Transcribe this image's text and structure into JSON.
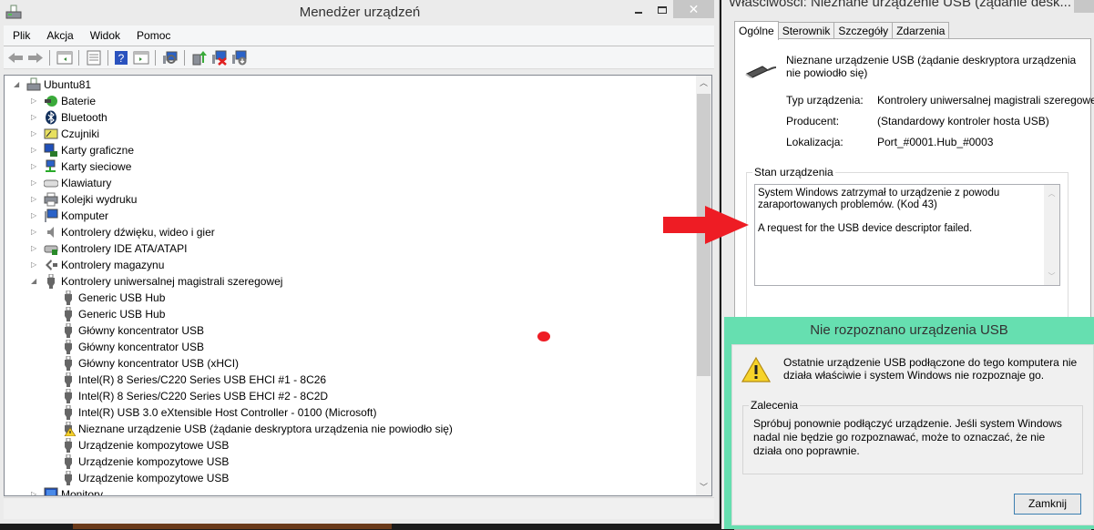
{
  "device_manager": {
    "title": "Menedżer urządzeń",
    "menu": [
      "Plik",
      "Akcja",
      "Widok",
      "Pomoc"
    ],
    "toolbar_icons": [
      "back-arrow-icon",
      "forward-arrow-icon",
      "show-hide-console-tree-icon",
      "properties-icon",
      "help-icon",
      "action-pane-icon",
      "scan-hardware-icon",
      "update-driver-icon",
      "uninstall-device-icon",
      "disable-device-icon"
    ],
    "tree": {
      "root": "Ubuntu81",
      "categories": [
        {
          "label": "Baterie",
          "icon": "battery-icon"
        },
        {
          "label": "Bluetooth",
          "icon": "bluetooth-icon"
        },
        {
          "label": "Czujniki",
          "icon": "sensor-icon"
        },
        {
          "label": "Karty graficzne",
          "icon": "display-adapter-icon"
        },
        {
          "label": "Karty sieciowe",
          "icon": "network-adapter-icon"
        },
        {
          "label": "Klawiatury",
          "icon": "keyboard-icon"
        },
        {
          "label": "Kolejki wydruku",
          "icon": "printer-icon"
        },
        {
          "label": "Komputer",
          "icon": "computer-icon"
        },
        {
          "label": "Kontrolery dźwięku, wideo i gier",
          "icon": "speaker-icon"
        },
        {
          "label": "Kontrolery IDE ATA/ATAPI",
          "icon": "ide-controller-icon"
        },
        {
          "label": "Kontrolery magazynu",
          "icon": "storage-controller-icon"
        },
        {
          "label": "Kontrolery uniwersalnej magistrali szeregowej",
          "icon": "usb-plug-icon",
          "expanded": true
        }
      ],
      "usb_children": [
        {
          "label": "Generic USB Hub",
          "warning": false
        },
        {
          "label": "Generic USB Hub",
          "warning": false
        },
        {
          "label": "Główny koncentrator USB",
          "warning": false
        },
        {
          "label": "Główny koncentrator USB",
          "warning": false
        },
        {
          "label": "Główny koncentrator USB (xHCI)",
          "warning": false
        },
        {
          "label": "Intel(R) 8 Series/C220 Series USB EHCI #1 - 8C26",
          "warning": false
        },
        {
          "label": "Intel(R) 8 Series/C220 Series USB EHCI #2 - 8C2D",
          "warning": false
        },
        {
          "label": "Intel(R) USB 3.0 eXtensible Host Controller - 0100 (Microsoft)",
          "warning": false
        },
        {
          "label": "Nieznane urządzenie USB (żądanie deskryptora urządzenia nie powiodło się)",
          "warning": true
        },
        {
          "label": "Urządzenie kompozytowe USB",
          "warning": false
        },
        {
          "label": "Urządzenie kompozytowe USB",
          "warning": false
        },
        {
          "label": "Urządzenie kompozytowe USB",
          "warning": false
        }
      ],
      "after": [
        {
          "label": "Monitory",
          "icon": "monitor-icon"
        }
      ]
    }
  },
  "properties": {
    "title": "Właściwości: Nieznane urządzenie USB (żądanie desk...",
    "tabs": [
      "Ogólne",
      "Sterownik",
      "Szczegóły",
      "Zdarzenia"
    ],
    "active_tab": "Ogólne",
    "device_name": "Nieznane urządzenie USB (żądanie deskryptora urządzenia nie powiodło się)",
    "rows": [
      {
        "key": "Typ urządzenia:",
        "value": "Kontrolery uniwersalnej magistrali szeregowej"
      },
      {
        "key": "Producent:",
        "value": "(Standardowy kontroler hosta USB)"
      },
      {
        "key": "Lokalizacja:",
        "value": "Port_#0001.Hub_#0003"
      }
    ],
    "status_label": "Stan urządzenia",
    "status_text_1": "System Windows zatrzymał to urządzenie z powodu zaraportowanych problemów. (Kod 43)",
    "status_text_2": "A request for the USB device descriptor failed."
  },
  "usb_dialog": {
    "title": "Nie rozpoznano urządzenia USB",
    "message": "Ostatnie urządzenie USB podłączone do tego komputera nie działa właściwie i system Windows nie rozpoznaje go.",
    "recommendations_label": "Zalecenia",
    "recommendations_text": "Spróbuj ponownie podłączyć urządzenie. Jeśli system Windows nadal nie będzie go rozpoznawać, może to oznaczać, że nie działa ono poprawnie.",
    "close_label": "Zamknij",
    "accent_color": "#66dfb0"
  },
  "annotation_color": "#ee1c24"
}
